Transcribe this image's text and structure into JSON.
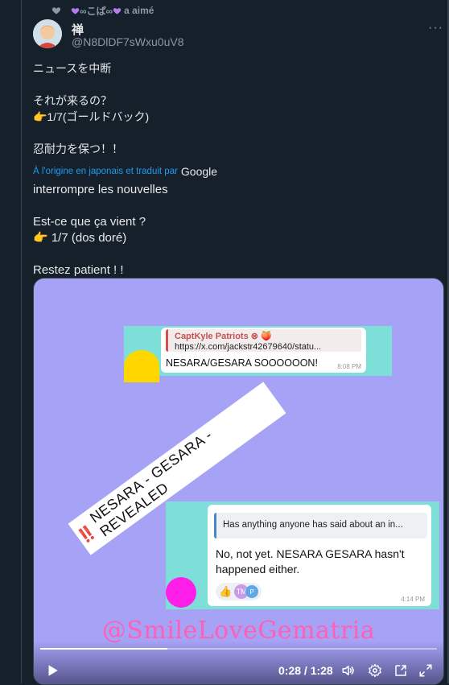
{
  "social_context": {
    "text": "∞こぱ∞",
    "action": "a aimé"
  },
  "author": {
    "name": "禅",
    "handle": "@N8DlDF7sWxu0uV8"
  },
  "tweet": {
    "original_lines": [
      "ニュースを中断",
      "",
      "それが来るの？",
      "👉1/7(ゴールドバック)",
      "",
      "忍耐力を保つ！！"
    ],
    "translation_note": "À l'origine en japonais et traduit par",
    "translation_provider": "Google",
    "translated_lines": [
      "interrompre les nouvelles",
      "",
      "Est-ce que ça vient ?",
      "👉 1/7 (dos doré)",
      "",
      "Restez patient ! !"
    ]
  },
  "media": {
    "card1": {
      "quote_title": "CaptKyle Patriots ⊗ 🍑",
      "quote_url": "https://x.com/jackstr42679640/statu...",
      "message": "NESARA/GESARA SOOOOOON!",
      "time": "8:08 PM"
    },
    "banner": {
      "bang": "‼️",
      "text": "NESARA - GESARA - REVEALED"
    },
    "card2": {
      "quote": "Has anything anyone has said about an in...",
      "message": "No, not yet. NESARA GESARA hasn't happened either.",
      "react_emoji": "👍",
      "react_initials_1": "TM",
      "react_initials_2": "P",
      "time": "4:14 PM"
    },
    "watermark": "@SmileLoveGematria"
  },
  "player": {
    "time": "0:28 / 1:28",
    "progress": 0.32
  },
  "colors": {
    "background": "#15202b",
    "link": "#1d9bf0",
    "media_bg": "#a6a3f7",
    "watermark": "#ff5fb4"
  },
  "icons": {
    "more": "more-icon",
    "play": "play-icon",
    "volume": "volume-icon",
    "settings": "gear-icon",
    "pip": "picture-in-picture-icon",
    "fullscreen": "fullscreen-icon"
  }
}
